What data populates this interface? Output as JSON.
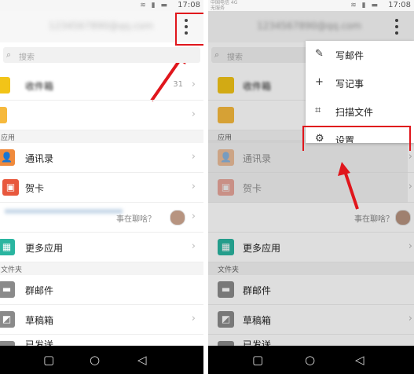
{
  "status": {
    "time": "17:08",
    "carrier": "中国电信 4G\n无服务"
  },
  "header": {
    "account": "1234567890@qq.com"
  },
  "search": {
    "placeholder": "搜索"
  },
  "inbox": {
    "label": "收件箱",
    "count": "31"
  },
  "sections": {
    "apps": "应用",
    "folders": "文件夹"
  },
  "apps": [
    {
      "label": "通讯录",
      "color": "#f08a3c"
    },
    {
      "label": "贺卡",
      "color": "#e8583d"
    },
    {
      "label": "更多应用",
      "color": "#2ab5a0"
    }
  ],
  "promo": {
    "text": "事在聊啥？"
  },
  "folders": [
    {
      "label": "群邮件"
    },
    {
      "label": "草稿箱"
    },
    {
      "label": "已发送"
    }
  ],
  "menu": {
    "items": [
      {
        "label": "写邮件",
        "icon": "compose-icon"
      },
      {
        "label": "写记事",
        "icon": "note-icon"
      },
      {
        "label": "扫描文件",
        "icon": "scan-icon"
      },
      {
        "label": "设置",
        "icon": "gear-icon"
      }
    ]
  },
  "annotation_color": "#e0161c"
}
